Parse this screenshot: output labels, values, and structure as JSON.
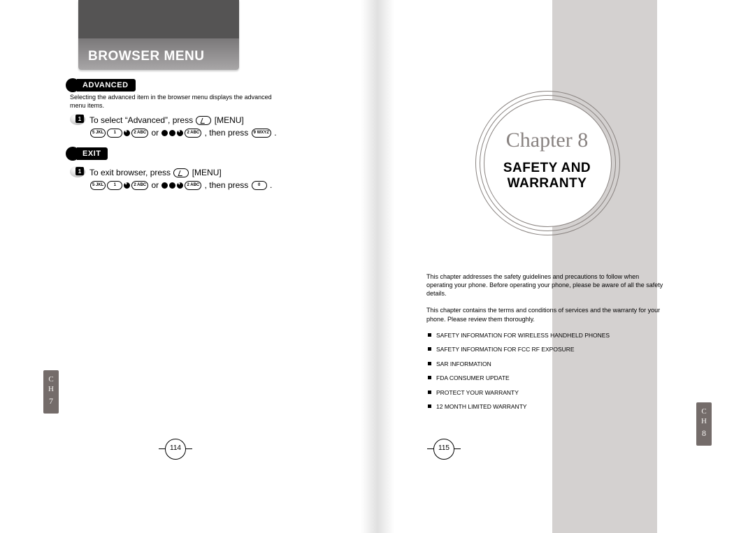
{
  "left": {
    "header": "BROWSER MENU",
    "sections": {
      "advanced": {
        "label": "ADVANCED",
        "intro": "Selecting the advanced item in the browser menu displays the advanced menu items.",
        "step": {
          "num": "1",
          "line1_a": "To select “Advanced”, press ",
          "line1_b": " [MENU]",
          "line2_mid": " or ",
          "line2_tail": " , then press "
        }
      },
      "exit": {
        "label": "EXIT",
        "step": {
          "num": "1",
          "line1_a": "To exit browser, press ",
          "line1_b": " [MENU]",
          "line2_mid": " or ",
          "line2_tail": " , then press "
        }
      }
    },
    "ch_tab": {
      "ch": "C\nH",
      "num": "7"
    },
    "page_num": "114"
  },
  "right": {
    "chapter_label": "Chapter 8",
    "chapter_title_l1": "SAFETY AND",
    "chapter_title_l2": "WARRANTY",
    "para1": "This chapter addresses the safety guidelines and precautions to follow when operating your phone. Before operating your phone, please be aware of all the safety details.",
    "para2": "This chapter contains the terms and conditions of services and the warranty for your phone. Please review them thoroughly.",
    "items": [
      "SAFETY INFORMATION FOR WIRELESS HANDHELD PHONES",
      "SAFETY INFORMATION FOR FCC RF EXPOSURE",
      "SAR INFORMATION",
      "FDA CONSUMER UPDATE",
      "PROTECT YOUR WARRANTY",
      "12 MONTH LIMITED WARRANTY"
    ],
    "ch_tab": {
      "ch": "C\nH",
      "num": "8"
    },
    "page_num": "115"
  },
  "keys": {
    "k5": "5 JKL",
    "k1": "1",
    "k2": "2 ABC",
    "k9": "9 WXYZ",
    "k0": "0"
  }
}
